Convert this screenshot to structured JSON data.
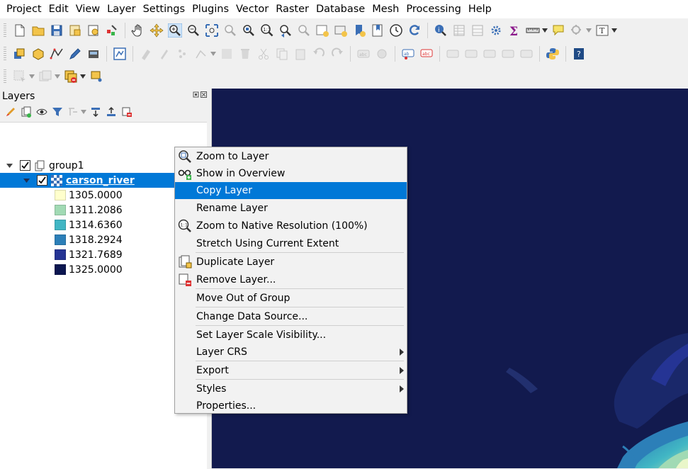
{
  "menubar": {
    "items": [
      "Project",
      "Edit",
      "View",
      "Layer",
      "Settings",
      "Plugins",
      "Vector",
      "Raster",
      "Database",
      "Mesh",
      "Processing",
      "Help"
    ]
  },
  "layers_panel": {
    "title": "Layers",
    "tree": {
      "group": {
        "name": "group1",
        "checked": true
      },
      "layer": {
        "name": "carson_river",
        "checked": true,
        "selected": true
      },
      "legend": [
        {
          "label": "1305.0000",
          "color": "#ffffcc"
        },
        {
          "label": "1311.2086",
          "color": "#a1dab4"
        },
        {
          "label": "1314.6360",
          "color": "#41b6c4"
        },
        {
          "label": "1318.2924",
          "color": "#2c7fb8"
        },
        {
          "label": "1321.7689",
          "color": "#253494"
        },
        {
          "label": "1325.0000",
          "color": "#0c1650"
        }
      ]
    }
  },
  "context_menu": {
    "items": [
      {
        "label": "Zoom to Layer",
        "icon": "zoom-layer-icon"
      },
      {
        "label": "Show in Overview",
        "icon": "overview-icon"
      },
      {
        "label": "Copy Layer",
        "highlighted": true
      },
      {
        "label": "Rename Layer"
      },
      {
        "label": "Zoom to Native Resolution (100%)",
        "icon": "zoom-native-icon"
      },
      {
        "label": "Stretch Using Current Extent"
      },
      {
        "label": "Duplicate Layer",
        "icon": "duplicate-icon"
      },
      {
        "label": "Remove Layer...",
        "icon": "remove-layer-icon"
      },
      {
        "label": "Move Out of Group"
      },
      {
        "label": "Change Data Source..."
      },
      {
        "label": "Set Layer Scale Visibility..."
      },
      {
        "label": "Layer CRS",
        "submenu": true
      },
      {
        "label": "Export",
        "submenu": true
      },
      {
        "label": "Styles",
        "submenu": true
      },
      {
        "label": "Properties..."
      }
    ]
  },
  "colors": {
    "selection": "#0078d7",
    "map_background": "#121a4e"
  }
}
